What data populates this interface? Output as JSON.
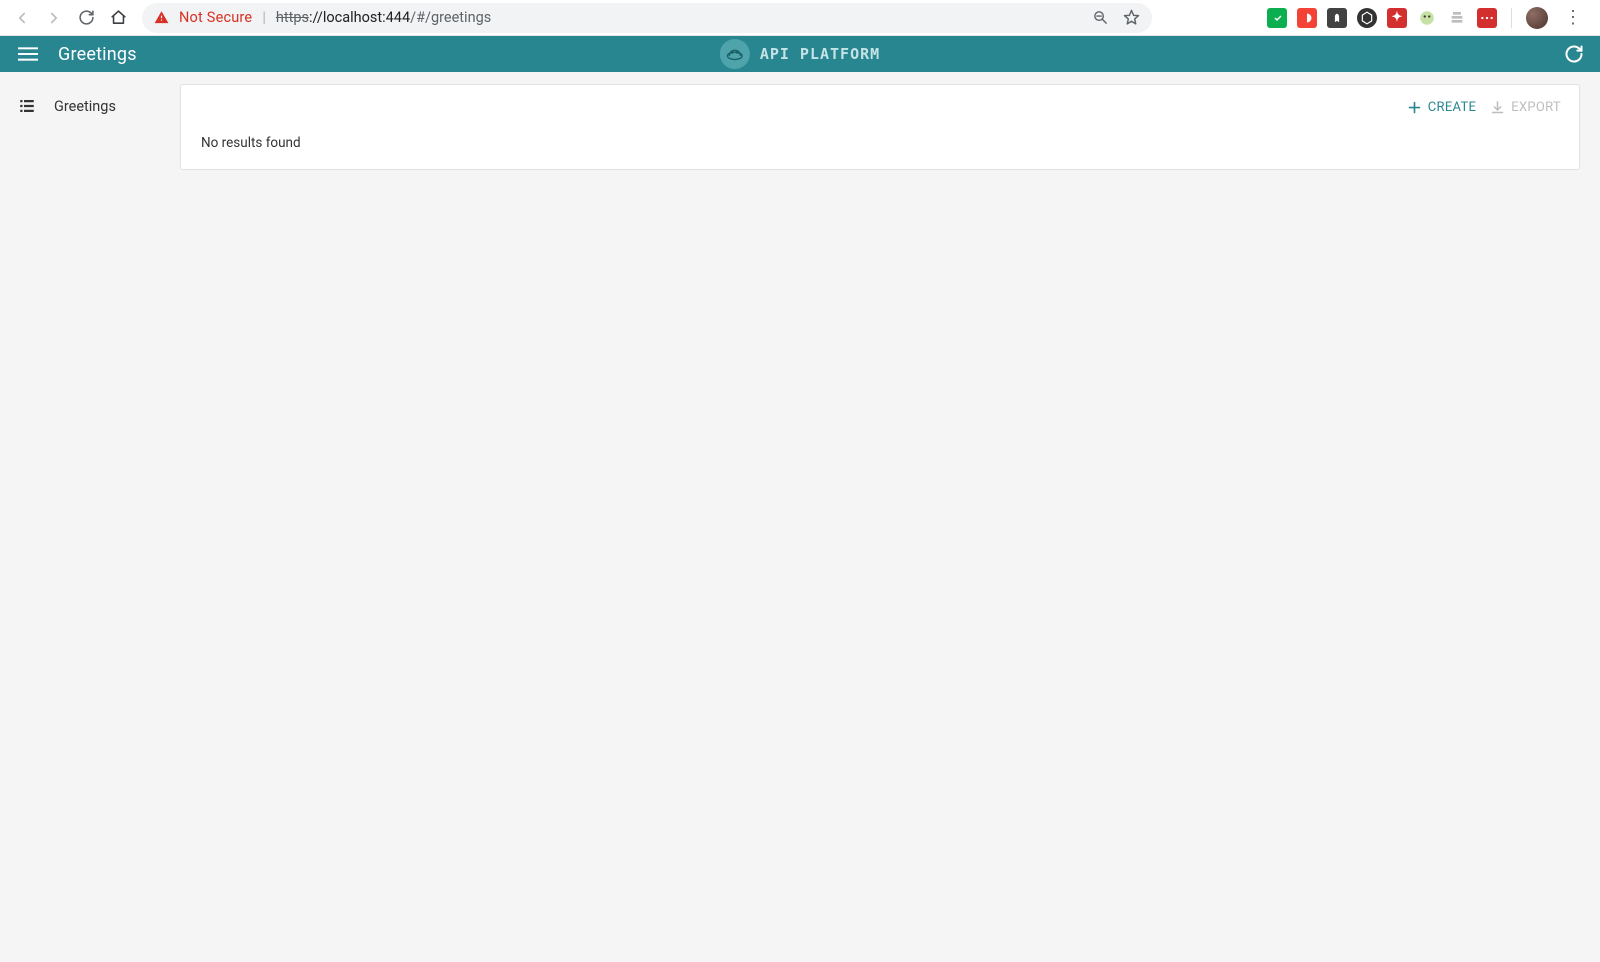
{
  "browser": {
    "security_label": "Not Secure",
    "url_scheme": "https",
    "url_after_scheme": "://localhost:444",
    "url_path": "/#/greetings"
  },
  "header": {
    "page_title": "Greetings",
    "brand_text": "API PLATFORM"
  },
  "sidebar": {
    "items": [
      {
        "label": "Greetings"
      }
    ]
  },
  "content": {
    "toolbar": {
      "create_label": "CREATE",
      "export_label": "EXPORT"
    },
    "empty_message": "No results found"
  },
  "colors": {
    "accent": "#288690",
    "danger": "#d93025",
    "muted": "#bdbdbd"
  }
}
